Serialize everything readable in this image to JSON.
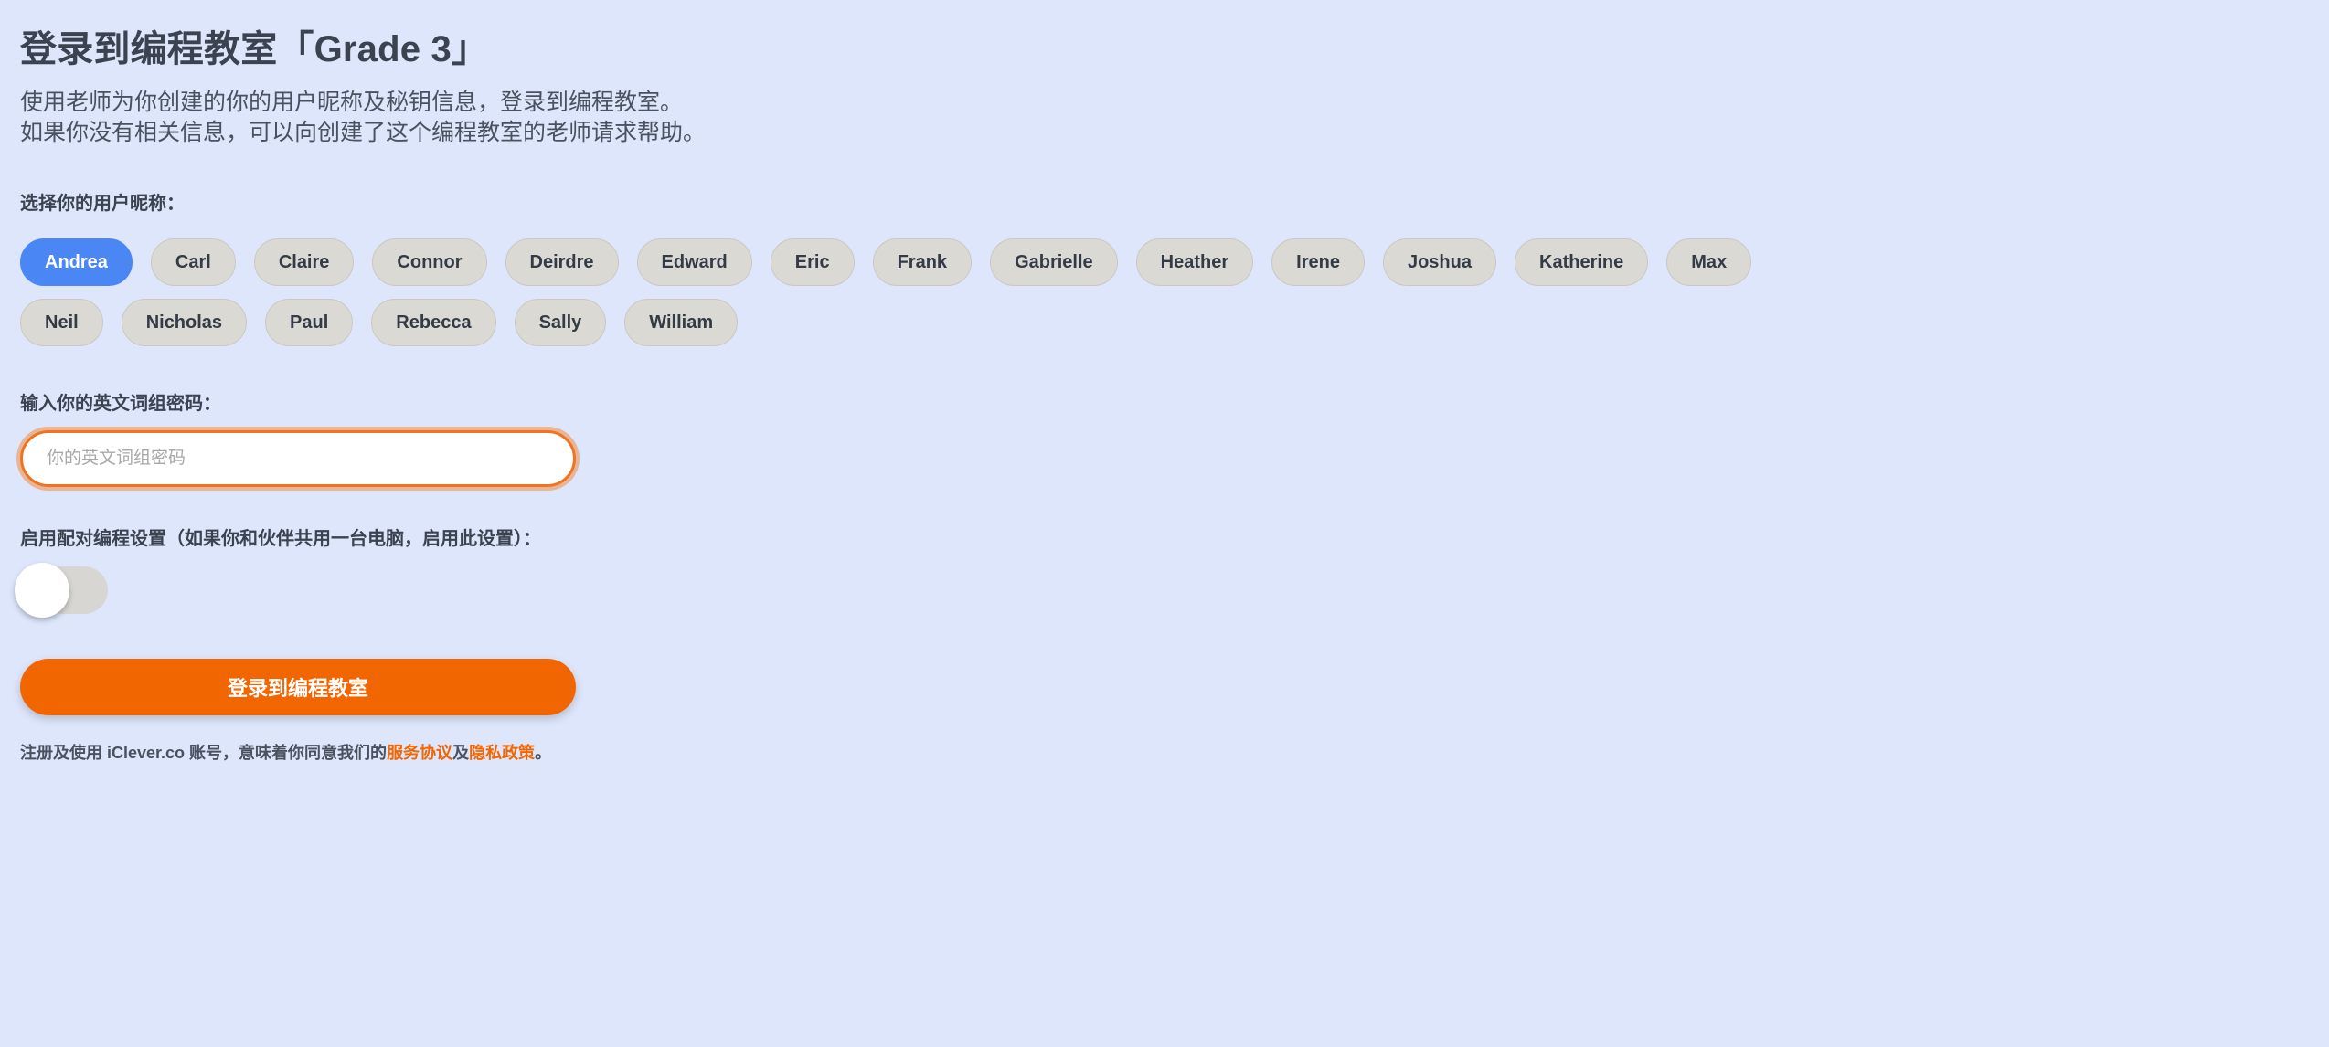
{
  "heading": {
    "title": "登录到编程教室「Grade 3」",
    "intro_line_1": "使用老师为你创建的你的用户昵称及秘钥信息，登录到编程教室。",
    "intro_line_2": "如果你没有相关信息，可以向创建了这个编程教室的老师请求帮助。"
  },
  "username_section": {
    "label": "选择你的用户昵称：",
    "selected": "Andrea",
    "rows": [
      [
        "Andrea",
        "Carl",
        "Claire",
        "Connor",
        "Deirdre",
        "Edward",
        "Eric",
        "Frank",
        "Gabrielle",
        "Heather",
        "Irene",
        "Joshua",
        "Katherine",
        "Max"
      ],
      [
        "Neil",
        "Nicholas",
        "Paul",
        "Rebecca",
        "Sally",
        "William"
      ]
    ]
  },
  "password_section": {
    "label": "输入你的英文词组密码：",
    "placeholder": "你的英文词组密码",
    "value": ""
  },
  "pair_section": {
    "label": "启用配对编程设置（如果你和伙伴共用一台电脑，启用此设置）：",
    "enabled": false
  },
  "submit": {
    "label": "登录到编程教室"
  },
  "footer": {
    "text_before": "注册及使用 iClever.co 账号，意味着你同意我们的",
    "terms_link": "服务协议",
    "separator": "及",
    "privacy_link": "隐私政策",
    "text_after": "。"
  },
  "colors": {
    "background": "#dde6fb",
    "accent_orange": "#f26602",
    "selected_blue": "#4a87f5",
    "chip_grey": "#dbd9d4",
    "text_dark": "#3b4350"
  }
}
